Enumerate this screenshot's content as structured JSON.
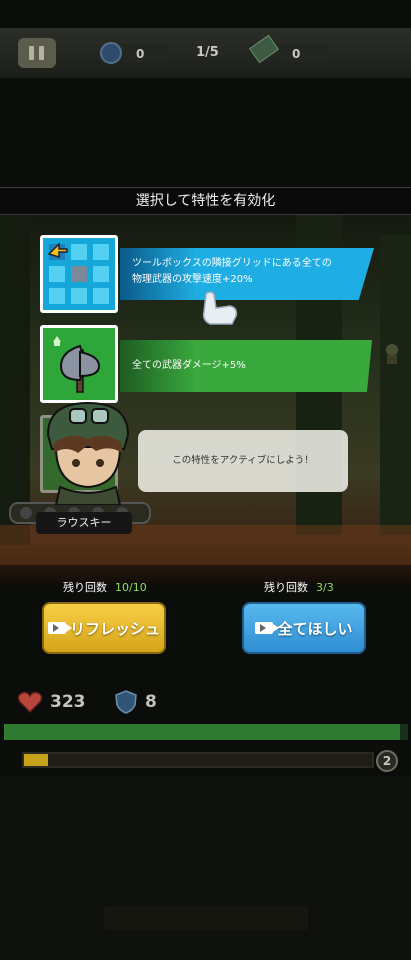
{
  "top_bar": {
    "coins": "0",
    "wave": "1/5",
    "cash": "0"
  },
  "banner": {
    "title": "選択して特性を有効化"
  },
  "traits": [
    {
      "icon": "toolbox-grid-icon",
      "text_line1": "ツールボックスの隣接グリッドにある全ての",
      "text_line2": "物理武器の攻撃速度+20%"
    },
    {
      "icon": "axe-icon",
      "text": "全ての武器ダメージ+5%"
    }
  ],
  "tutorial": {
    "bubble_text": "この特性をアクティブにしよう！"
  },
  "character": {
    "name": "ラウスキー"
  },
  "refresh": {
    "label": "残り回数",
    "count": "10/10",
    "button": "リフレッシュ"
  },
  "take_all": {
    "label": "残り回数",
    "count": "3/3",
    "button": "全てほしい"
  },
  "hud": {
    "hp": "323",
    "armor": "8",
    "hp_progress": 0.98,
    "xp_progress": 0.07,
    "level": "2"
  },
  "colors": {
    "accent_green": "#8ee25b",
    "button_yellow": "#f0c030",
    "button_blue": "#3a9fe0"
  }
}
